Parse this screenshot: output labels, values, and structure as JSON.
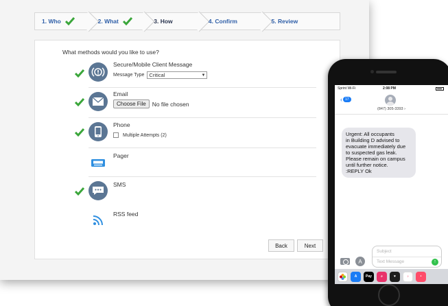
{
  "stepper": {
    "steps": [
      {
        "label": "1. Who",
        "completed": true
      },
      {
        "label": "2. What",
        "completed": true
      },
      {
        "label": "3. How",
        "completed": false,
        "current": true
      },
      {
        "label": "4. Confirm",
        "completed": false
      },
      {
        "label": "5. Review",
        "completed": false
      }
    ]
  },
  "form": {
    "question": "What methods would you like to use?",
    "methods": {
      "secure": {
        "label": "Secure/Mobile Client Message",
        "checked": true,
        "icon": "alert-broadcast-icon",
        "message_type_label": "Message Type",
        "message_type_value": "Critical"
      },
      "email": {
        "label": "Email",
        "checked": true,
        "icon": "envelope-icon",
        "file_button": "Choose File",
        "file_status": "No file chosen"
      },
      "phone": {
        "label": "Phone",
        "checked": true,
        "icon": "mobile-phone-icon",
        "option_label": "Multiple Attempts (2)",
        "option_checked": false
      },
      "pager": {
        "label": "Pager",
        "checked": false,
        "icon": "pager-icon"
      },
      "sms": {
        "label": "SMS",
        "checked": true,
        "icon": "chat-bubble-icon"
      },
      "rss": {
        "label": "RSS feed",
        "checked": false,
        "icon": "rss-icon"
      }
    },
    "back_label": "Back",
    "next_label": "Next"
  },
  "phone": {
    "carrier": "Sprint Wi-Fi",
    "time": "2:08 PM",
    "back_count": "17",
    "contact_number": "(847) 305-3393",
    "message_lines": [
      "Urgent: All occupants",
      "in Building D advised to",
      "evacuate immediately due",
      "to suspected gas leak.",
      "Please remain on campus",
      "until further notice.",
      ":REPLY Ok"
    ],
    "subject_placeholder": "Subject",
    "text_placeholder": "Text Message",
    "apps": [
      "photos-icon",
      "app-store-icon",
      "apple-pay-icon",
      "search-gif-icon",
      "heart-icon",
      "music-icon",
      "more-icon"
    ],
    "apps_pay_label": "Pay"
  },
  "colors": {
    "check_green": "#3aa63a",
    "step_blue": "#2f5fa8",
    "icon_slate": "#5b7694",
    "icon_blue": "#2f8fe0",
    "imessage_blue": "#1a7cf5",
    "send_green": "#33c24d"
  }
}
